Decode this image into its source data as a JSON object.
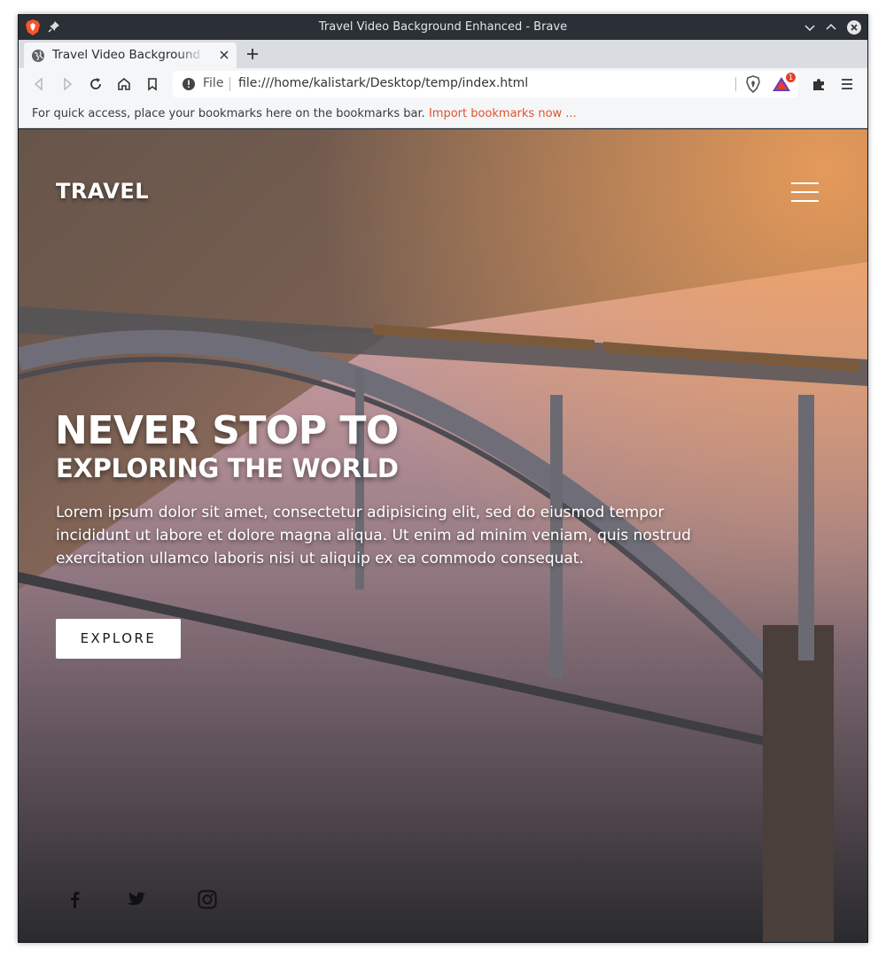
{
  "window": {
    "title": "Travel Video Background Enhanced - Brave"
  },
  "tab": {
    "label": "Travel Video Background Enhanced - Brave"
  },
  "address_bar": {
    "scheme": "File",
    "url": "file:///home/kalistark/Desktop/temp/index.html",
    "rewards_badge": "1"
  },
  "bookmarks_bar": {
    "message": "For quick access, place your bookmarks here on the bookmarks bar.",
    "import_link": "Import bookmarks now ..."
  },
  "site": {
    "brand": "TRAVEL",
    "headline": "NEVER STOP TO",
    "subheadline": "EXPLORING THE WORLD",
    "paragraph": "Lorem ipsum dolor sit amet, consectetur adipisicing elit, sed do eiusmod tempor incididunt ut labore et dolore magna aliqua. Ut enim ad minim veniam, quis nostrud exercitation ullamco laboris nisi ut aliquip ex ea commodo consequat.",
    "cta_label": "EXPLORE",
    "social_icons": [
      "facebook-icon",
      "twitter-icon",
      "instagram-icon"
    ]
  },
  "colors": {
    "accent_link": "#e0542c",
    "titlebar": "#2b2f36",
    "toolbar": "#f5f6f8"
  }
}
